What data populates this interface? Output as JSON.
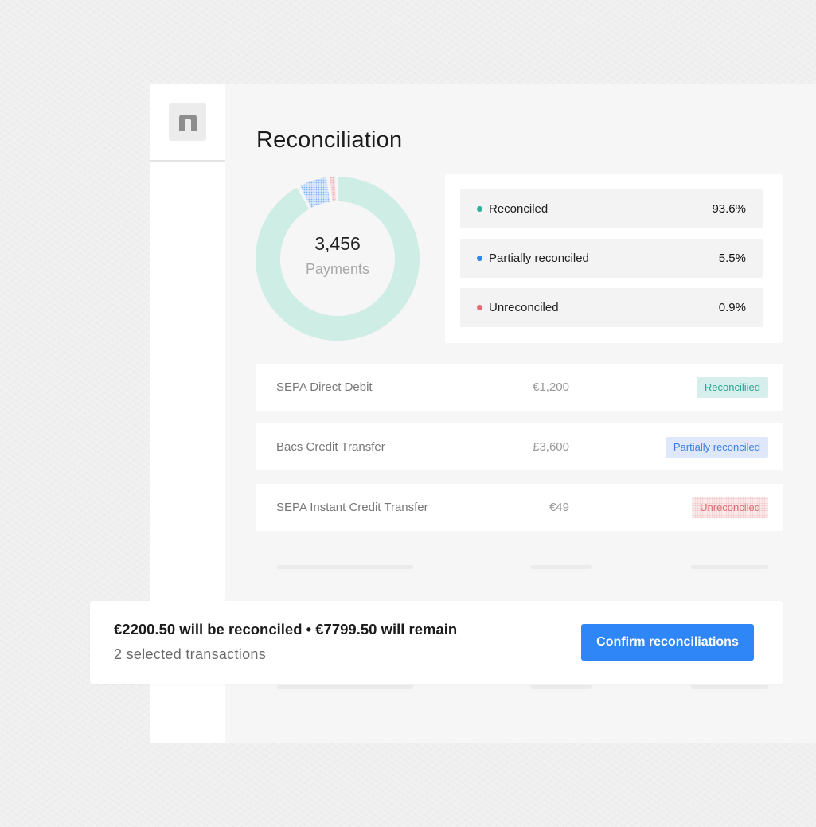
{
  "page": {
    "title": "Reconciliation"
  },
  "summary": {
    "count": "3,456",
    "count_label": "Payments"
  },
  "colors": {
    "reconciled": "#2bb39c",
    "reconciled_ring": "#cdede5",
    "partial": "#2f86f7",
    "unreconciled": "#e56b75",
    "accent": "#2f86f7"
  },
  "legend": [
    {
      "name": "Reconciled",
      "pct": "93.6%",
      "color": "#2bb39c",
      "share": 93.6
    },
    {
      "name": "Partially reconciled",
      "pct": "5.5%",
      "color": "#2f86f7",
      "share": 5.5
    },
    {
      "name": "Unreconciled",
      "pct": "0.9%",
      "color": "#e56b75",
      "share": 0.9
    }
  ],
  "transactions": [
    {
      "name": "SEPA Direct Debit",
      "amount": "€1,200",
      "status": "Reconciliied"
    },
    {
      "name": "Bacs Credit Transfer",
      "amount": "£3,600",
      "status": "Partially reconciled"
    },
    {
      "name": "SEPA Instant Credit Transfer",
      "amount": "€49",
      "status": "Unreconciled"
    }
  ],
  "confirm": {
    "summary": "€2200.50 will be reconciled • €7799.50 will remain",
    "selected": "2 selected transactions",
    "button_label": "Confirm reconciliations"
  }
}
